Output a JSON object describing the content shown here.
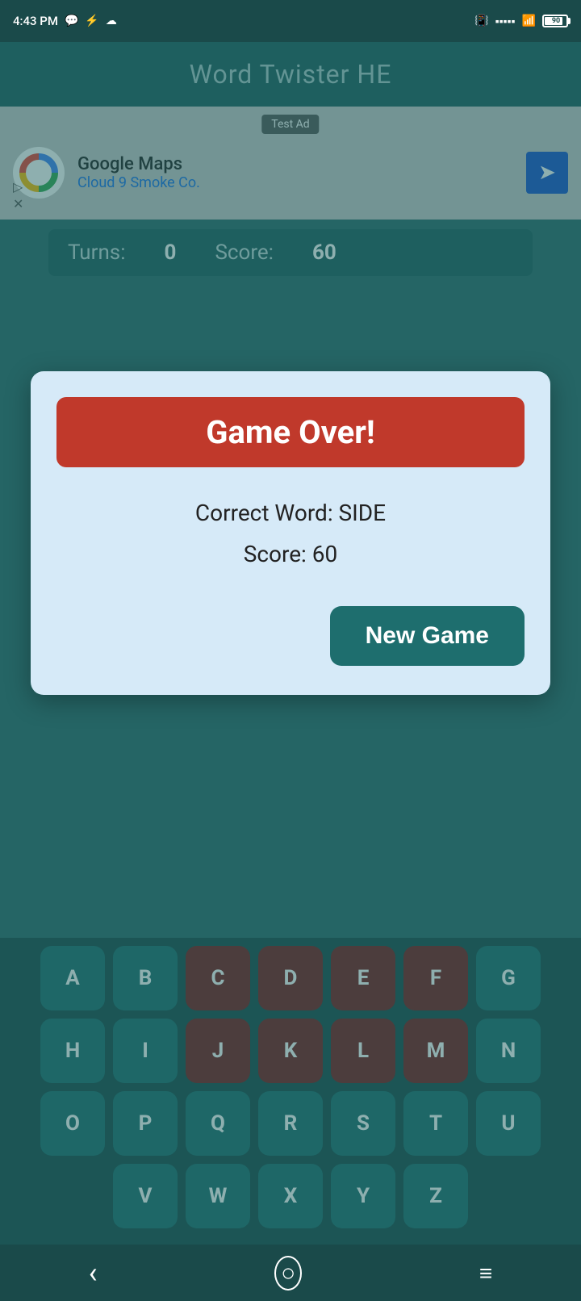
{
  "statusBar": {
    "time": "4:43 PM",
    "battery": "90"
  },
  "header": {
    "title": "Word Twister HE"
  },
  "ad": {
    "label": "Test Ad",
    "advertiser": "Google Maps",
    "tagline": "Cloud 9 Smoke Co."
  },
  "gameStats": {
    "turnsLabel": "Turns:",
    "turnsValue": "0",
    "scoreLabel": "Score:",
    "scoreValue": "60"
  },
  "modal": {
    "title": "Game Over!",
    "correctWordLabel": "Correct Word: SIDE",
    "scoreLabel": "Score: 60",
    "newGameButton": "New Game"
  },
  "keyboard": {
    "rows": [
      [
        "A",
        "B",
        "C",
        "D",
        "E",
        "F",
        "G"
      ],
      [
        "H",
        "I",
        "J",
        "K",
        "L",
        "M",
        "N"
      ],
      [
        "O",
        "P",
        "Q",
        "R",
        "S",
        "T",
        "U"
      ],
      [
        "V",
        "W",
        "X",
        "Y",
        "Z"
      ]
    ],
    "usedKeys": [
      "C",
      "D",
      "E",
      "F",
      "J",
      "K",
      "L",
      "M"
    ]
  },
  "navBar": {
    "back": "‹",
    "home": "○",
    "menu": "≡"
  }
}
